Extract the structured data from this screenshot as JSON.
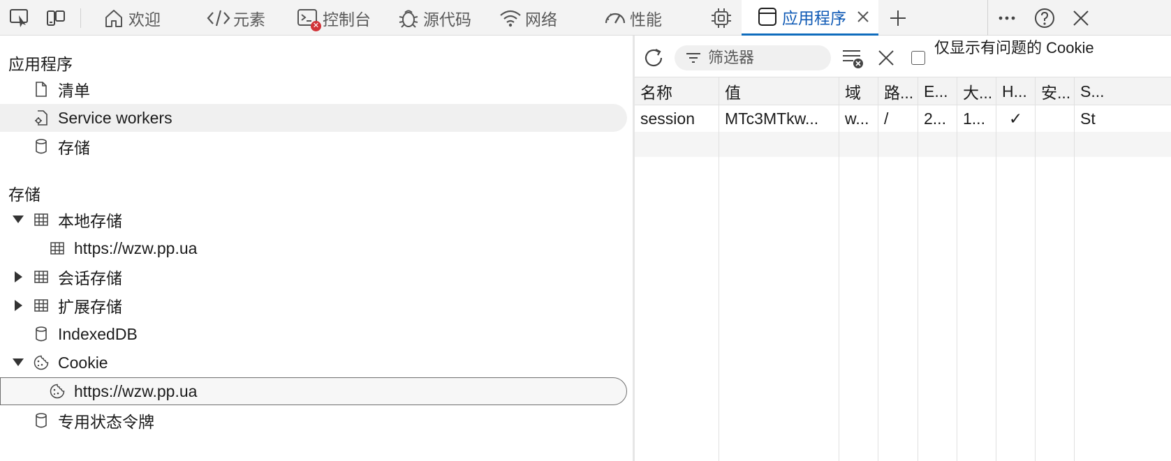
{
  "toolbar_tabs": {
    "welcome": "欢迎",
    "elements": "元素",
    "console": "控制台",
    "sources": "源代码",
    "network": "网络",
    "performance": "性能",
    "application": "应用程序"
  },
  "sidebar": {
    "app_section_title": "应用程序",
    "app_items": [
      "清单",
      "Service workers",
      "存储"
    ],
    "storage_section_title": "存储",
    "local_storage": "本地存储",
    "local_storage_origin": "https://wzw.pp.ua",
    "session_storage": "会话存储",
    "extension_storage": "扩展存储",
    "indexeddb": "IndexedDB",
    "cookies": "Cookie",
    "cookie_origin": "https://wzw.pp.ua",
    "private_state_tokens": "专用状态令牌"
  },
  "cookie_toolbar": {
    "filter_placeholder": "筛选器",
    "only_issues_label": "仅显示有问题的 Cookie",
    "only_issues_checked": false
  },
  "cookie_table": {
    "headers": [
      "名称",
      "值",
      "域",
      "路...",
      "E...",
      "大...",
      "H...",
      "安...",
      "S..."
    ],
    "rows": [
      [
        "session",
        "MTc3MTkw...",
        "w...",
        "/",
        "2...",
        "1...",
        "✓",
        "",
        "St"
      ]
    ]
  },
  "colors": {
    "accent": "#0f6cbd",
    "active_tab_text": "#0f5ab5",
    "error_badge": "#d13438"
  }
}
